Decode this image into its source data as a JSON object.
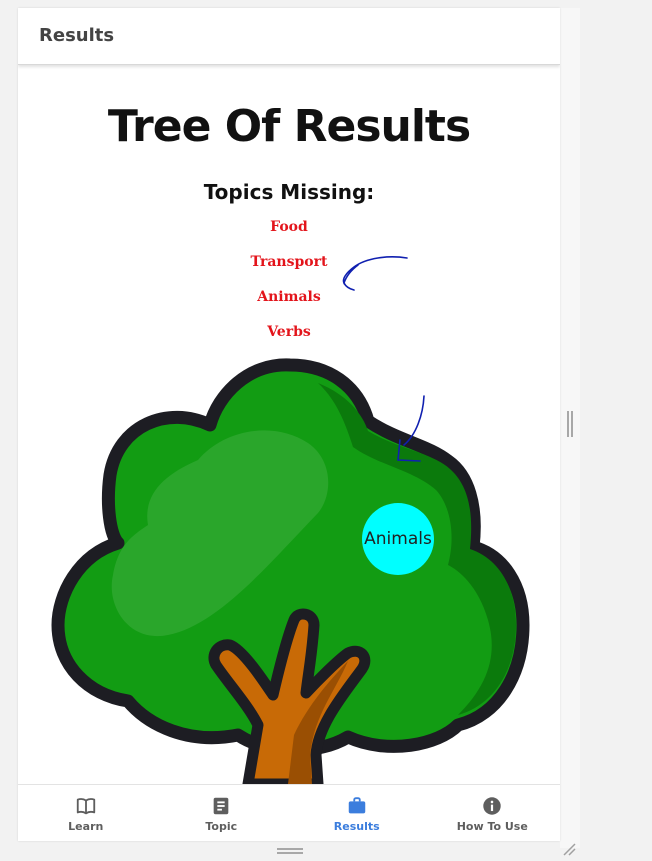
{
  "appbar": {
    "title": "Results"
  },
  "main": {
    "title": "Tree Of Results",
    "subtitle": "Topics Missing:",
    "missing_topics": [
      "Food",
      "Transport",
      "Animals",
      "Verbs"
    ],
    "badge_label": "Animals"
  },
  "bottom_nav": {
    "items": [
      {
        "label": "Learn",
        "icon": "book-icon",
        "active": false
      },
      {
        "label": "Topic",
        "icon": "document-icon",
        "active": false
      },
      {
        "label": "Results",
        "icon": "briefcase-icon",
        "active": true
      },
      {
        "label": "How To Use",
        "icon": "info-icon",
        "active": false
      }
    ]
  },
  "colors": {
    "missing_text": "#e3141b",
    "active_nav": "#3b7ddd",
    "inactive_nav": "#5e5e5e",
    "badge": "#00ffff",
    "foliage": "#129c13",
    "foliage_shadow": "#0b7a0c",
    "outline": "#1d1d23",
    "trunk": "#c86a06",
    "trunk_shadow": "#9a4f03",
    "annotation": "#1020b0"
  }
}
